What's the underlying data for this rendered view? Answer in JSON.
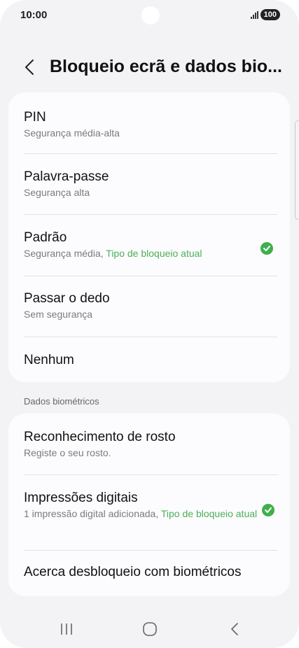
{
  "status_bar": {
    "time": "10:00",
    "battery": "100"
  },
  "header": {
    "title": "Bloqueio ecrã e dados bio..."
  },
  "lock_types": [
    {
      "title": "PIN",
      "subtitle": "Segurança média-alta"
    },
    {
      "title": "Palavra-passe",
      "subtitle": "Segurança alta"
    },
    {
      "title": "Padrão",
      "subtitle": "Segurança média,",
      "subtitle_accent": "Tipo de bloqueio atual",
      "selected": true
    },
    {
      "title": "Passar o dedo",
      "subtitle": "Sem segurança"
    },
    {
      "title": "Nenhum"
    }
  ],
  "biometrics": {
    "section_label": "Dados biométricos",
    "items": [
      {
        "title": "Reconhecimento de rosto",
        "subtitle": "Registe o seu rosto."
      },
      {
        "title": "Impressões digitais",
        "subtitle": "1 impressão digital adicionada,",
        "subtitle_accent": "Tipo de bloqueio atual",
        "selected": true
      },
      {
        "title": "Acerca desbloqueio com biométricos"
      }
    ]
  },
  "icons": {
    "back": "chevron-left-icon",
    "check": "check-circle-icon",
    "recents": "recent-apps-icon",
    "home": "home-icon",
    "nav_back": "nav-back-icon"
  },
  "colors": {
    "accent_green": "#4cae56",
    "background": "#f3f3f6",
    "card": "#fcfcfe"
  }
}
